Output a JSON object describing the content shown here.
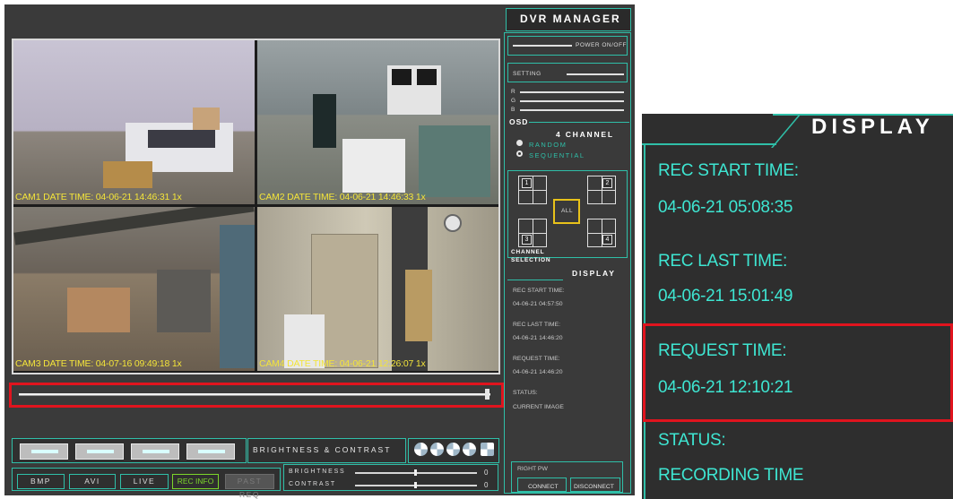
{
  "app": {
    "title": "DVR MANAGER"
  },
  "cameras": [
    {
      "caption": "CAM1 DATE TIME: 04-06-21 14:46:31   1x"
    },
    {
      "caption": "CAM2 DATE TIME: 04-06-21 14:46:33   1x"
    },
    {
      "caption": "CAM3 DATE TIME: 04-07-16 09:49:18   1x"
    },
    {
      "caption": "CAM4 DATE TIME: 04-06-21 12:26:07   1x"
    }
  ],
  "playback": {
    "progress": 0.99
  },
  "adjust": {
    "label": "BRIGHTNESS & CONTRAST",
    "brightness_label": "BRIGHTNESS",
    "contrast_label": "CONTRAST",
    "brightness_value": "0",
    "contrast_value": "0"
  },
  "mode_buttons": {
    "bmp": "BMP",
    "avi": "AVI",
    "live": "LIVE",
    "rec_info": "REC INFO",
    "past_req": "PAST REQ"
  },
  "side": {
    "power": "POWER ON/OFF",
    "setting": "SETTING",
    "rgb": [
      "R",
      "G",
      "B"
    ],
    "osd": "OSD",
    "channel_count": "4 CHANNEL",
    "modes": [
      "RANDOM",
      "SEQUENTIAL"
    ],
    "channels": [
      "1",
      "2",
      "3",
      "4"
    ],
    "all": "ALL",
    "channel_selection_1": "CHANNEL",
    "channel_selection_2": "SELECTION",
    "display_title": "DISPLAY",
    "rec_start_label": "REC START TIME:",
    "rec_start_value": "04-06-21  04:57:50",
    "rec_last_label": "REC LAST TIME:",
    "rec_last_value": "04-06-21  14:46:20",
    "request_label": "REQUEST TIME:",
    "request_value": "04-06-21  14:46:20",
    "status_label": "STATUS:",
    "status_value": "CURRENT IMAGE",
    "right_pw": "RIGHT PW",
    "connect": "CONNECT",
    "disconnect": "DISCONNECT"
  },
  "zoom": {
    "title": "DISPLAY",
    "rec_start_label": "REC START TIME:",
    "rec_start_value": "04-06-21  05:08:35",
    "rec_last_label": "REC LAST TIME:",
    "rec_last_value": "04-06-21  15:01:49",
    "request_label": "REQUEST TIME:",
    "request_value": "04-06-21  12:10:21",
    "status_label": "STATUS:",
    "status_value": "RECORDING TIME"
  },
  "colors": {
    "accent": "#2fbfa8",
    "highlight": "#e0141e",
    "caption": "#f3e43a",
    "zoom_text": "#3ee6d2"
  }
}
